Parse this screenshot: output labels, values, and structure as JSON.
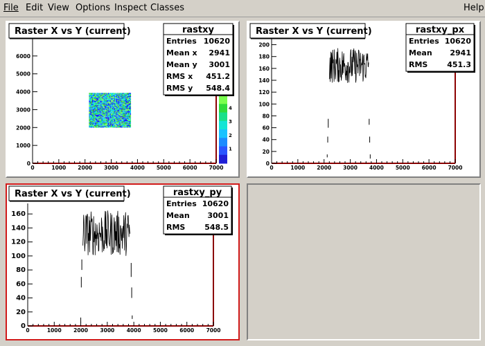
{
  "menu": {
    "file": "File",
    "edit": "Edit",
    "view": "View",
    "options": "Options",
    "inspect": "Inspect",
    "classes": "Classes",
    "help": "Help"
  },
  "colors": {
    "pad_active_border": "#d11a1a",
    "frame_border": "#8b0000",
    "hist_line": "#000000",
    "background": "#d4d0c8"
  },
  "pads": {
    "xy": {
      "title": "Raster X vs Y (current)",
      "stats": {
        "name": "rastxy",
        "rows": [
          {
            "label": "Entries",
            "value": "10620"
          },
          {
            "label": "Mean x",
            "value": "2941"
          },
          {
            "label": "Mean y",
            "value": "3001"
          },
          {
            "label": "RMS x",
            "value": "451.2"
          },
          {
            "label": "RMS y",
            "value": "548.4"
          }
        ]
      },
      "x_ticks": [
        "0",
        "1000",
        "2000",
        "3000",
        "4000",
        "5000",
        "6000",
        "7000"
      ],
      "y_ticks": [
        "0",
        "1000",
        "2000",
        "3000",
        "4000",
        "5000",
        "6000"
      ],
      "palette_ticks": [
        "1",
        "2",
        "3",
        "4"
      ]
    },
    "px": {
      "title": "Raster X vs Y (current)",
      "stats": {
        "name": "rastxy_px",
        "rows": [
          {
            "label": "Entries",
            "value": "10620"
          },
          {
            "label": "Mean",
            "value": "2941"
          },
          {
            "label": "RMS",
            "value": "451.3"
          }
        ]
      },
      "x_ticks": [
        "0",
        "1000",
        "2000",
        "3000",
        "4000",
        "5000",
        "6000",
        "7000"
      ],
      "y_ticks": [
        "0",
        "20",
        "40",
        "60",
        "80",
        "100",
        "120",
        "140",
        "160",
        "180",
        "200"
      ]
    },
    "py": {
      "title": "Raster X vs Y (current)",
      "stats": {
        "name": "rastxy_py",
        "rows": [
          {
            "label": "Entries",
            "value": "10620"
          },
          {
            "label": "Mean",
            "value": "3001"
          },
          {
            "label": "RMS",
            "value": "548.5"
          }
        ]
      },
      "x_ticks": [
        "0",
        "1000",
        "2000",
        "3000",
        "4000",
        "5000",
        "6000",
        "7000"
      ],
      "y_ticks": [
        "0",
        "20",
        "40",
        "60",
        "80",
        "100",
        "120",
        "140",
        "160"
      ]
    }
  },
  "chart_data": [
    {
      "type": "heatmap",
      "name": "rastxy",
      "title": "Raster X vs Y (current)",
      "xlim": [
        0,
        7000
      ],
      "ylim": [
        0,
        7000
      ],
      "filled_region": {
        "x": [
          2150,
          3750
        ],
        "y": [
          2000,
          3900
        ]
      },
      "z_range": [
        0,
        5
      ],
      "legend": "top-right"
    },
    {
      "type": "line",
      "name": "rastxy_px",
      "title": "Raster X vs Y (current)",
      "xlim": [
        0,
        7000
      ],
      "ylim": [
        0,
        210
      ],
      "plateau_range": [
        2150,
        3750
      ],
      "plateau_level_approx": [
        130,
        200
      ],
      "legend": "top-right"
    },
    {
      "type": "line",
      "name": "rastxy_py",
      "title": "Raster X vs Y (current)",
      "xlim": [
        0,
        7000
      ],
      "ylim": [
        0,
        175
      ],
      "plateau_range": [
        2000,
        3900
      ],
      "plateau_level_approx": [
        95,
        165
      ],
      "legend": "top-right"
    }
  ]
}
